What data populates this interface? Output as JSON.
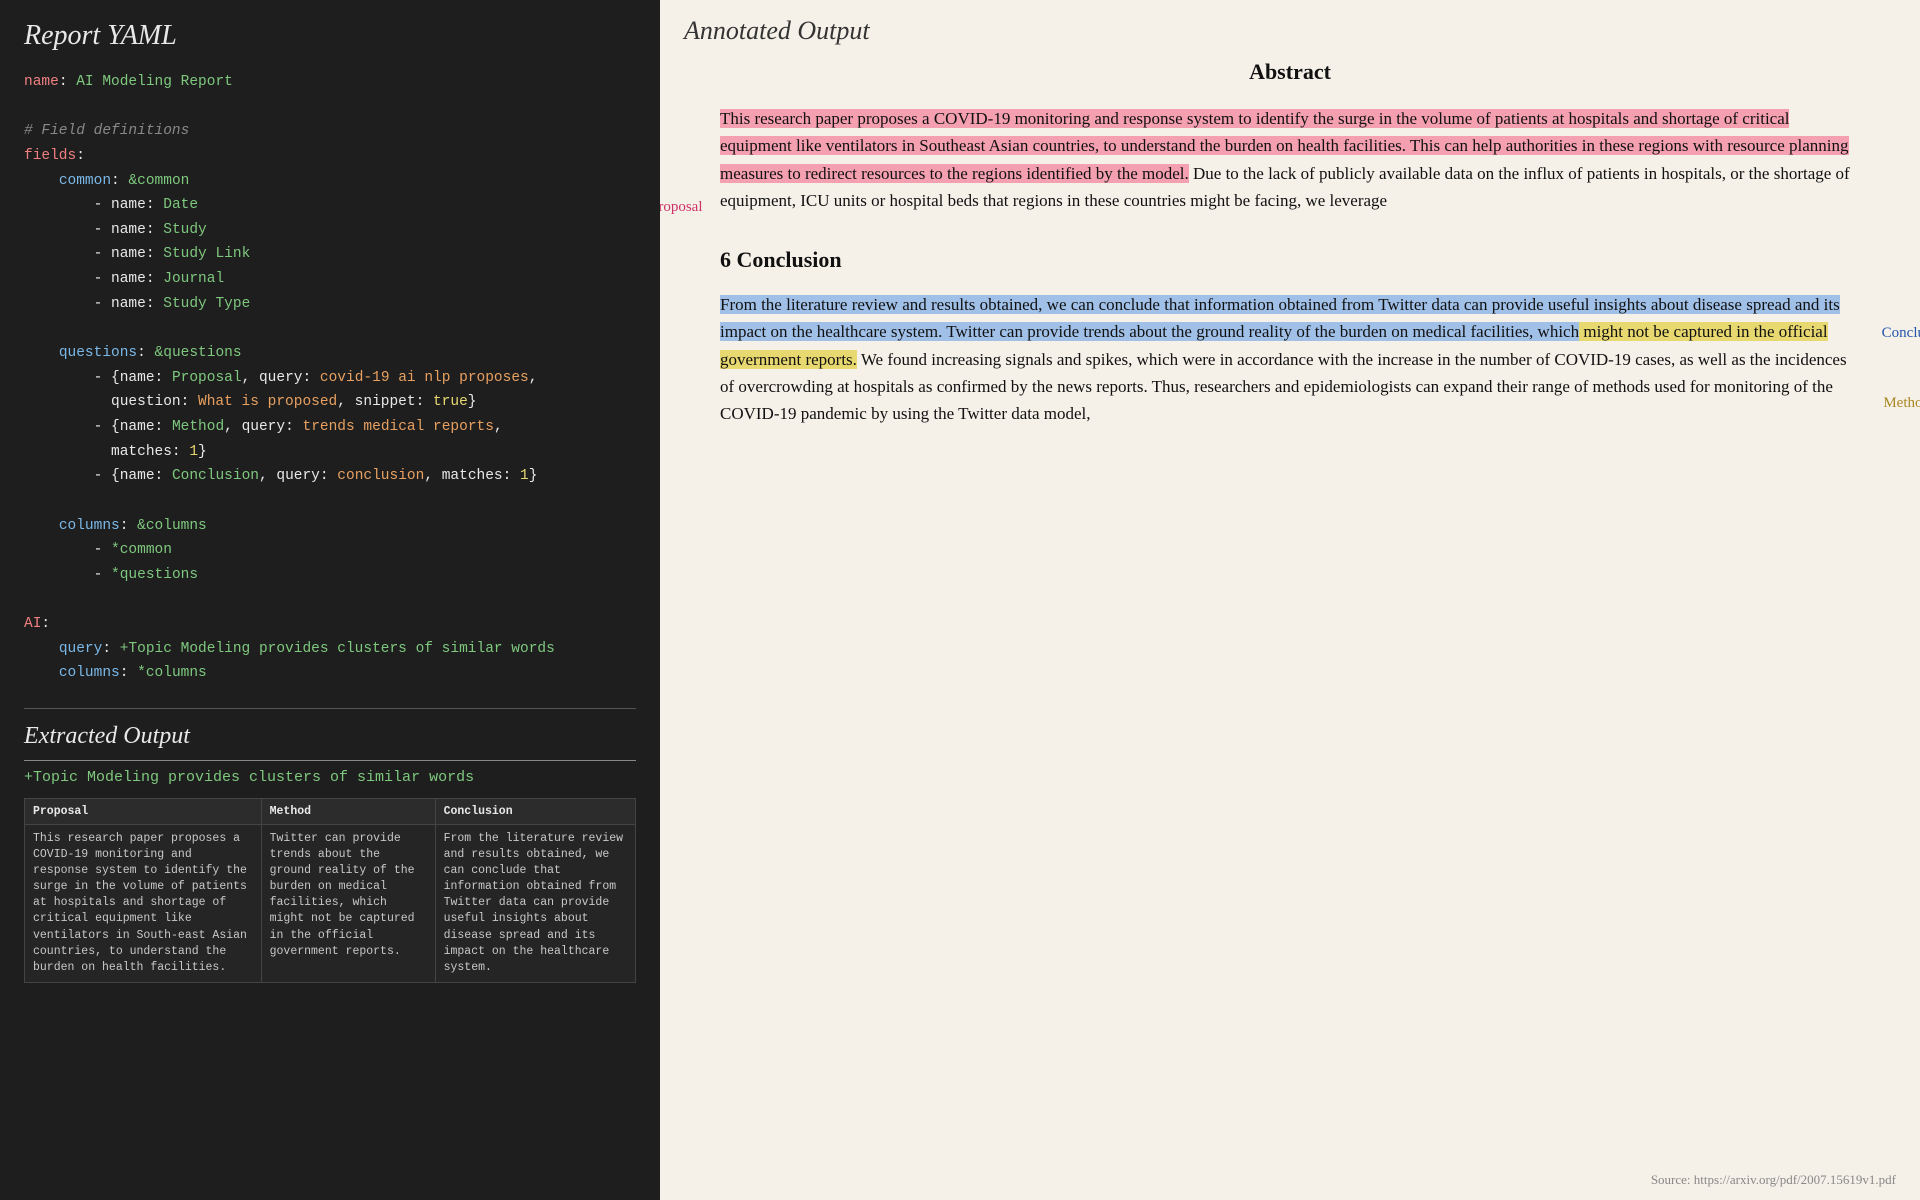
{
  "left": {
    "title": "Report YAML",
    "extracted_title": "Extracted Output",
    "yaml_lines": [],
    "extracted_query": "+Topic Modeling provides clusters of similar words",
    "table": {
      "headers": [
        "Proposal",
        "Method",
        "Conclusion"
      ],
      "rows": [
        [
          "This research paper proposes a COVID-19 monitoring and response system to identify the surge in the volume of patients at hospitals and shortage of critical equipment like ventilators in South-east Asian countries, to understand the burden on health facilities.",
          "Twitter can provide trends about the ground reality of the burden on medical facilities, which might not be captured in the official government reports.",
          "From the literature review and results obtained, we can conclude that information obtained from Twitter data can provide useful insights about disease spread and its impact on the healthcare system."
        ]
      ]
    }
  },
  "right": {
    "header": "Annotated Output",
    "abstract_title": "Abstract",
    "abstract_text": "This research paper proposes a COVID-19 monitoring and response system to identify the surge in the volume of patients at hospitals and shortage of critical equipment like ventilators in Southeast Asian countries, to understand the burden on health facilities.  This can help authorities in these regions with resource planning measures to redirect resources to the regions identified by the model.  Due to the lack of publicly available data on the influx of patients in hospitals, or the shortage of equipment, ICU units or hospital beds that regions in these countries might be facing, we leverage",
    "proposal_label": "Proposal",
    "conclusion_section_heading": "6   Conclusion",
    "conclusion_text_part1": "From the literature review and results obtained, we can conclude that information obtained from Twitter data can provide useful insights about disease spread and its impact on the healthcare system.",
    "conclusion_text_part2": "  Twitter can provide trends about the ground reality of the burden on medical facilities, which might not be captured in the official government reports.",
    "conclusion_text_rest": " We found increasing signals and spikes, which were in accordance with the increase in the number of COVID-19 cases, as well as the incidences of overcrowding at hospitals as confirmed by the news reports. Thus, researchers and epidemiologists can expand their range of methods used for monitoring of the COVID-19 pandemic by using the Twitter data model,",
    "conclusion_label": "Conclusion",
    "method_label": "Method",
    "source": "Source: https://arxiv.org/pdf/2007.15619v1.pdf"
  }
}
